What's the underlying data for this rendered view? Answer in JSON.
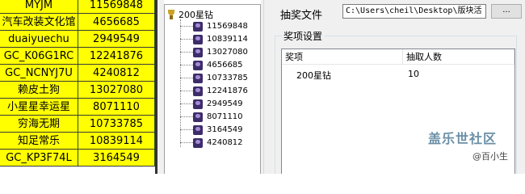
{
  "left_table": {
    "rows": [
      {
        "name": "MYJM",
        "id": "11569848"
      },
      {
        "name": "汽车改装文化馆",
        "id": "4656685"
      },
      {
        "name": "duaiyuechu",
        "id": "2949549"
      },
      {
        "name": "GC_K06G1RC",
        "id": "12241876"
      },
      {
        "name": "GC_NCNYJ7U",
        "id": "4240812"
      },
      {
        "name": "赖皮土狗",
        "id": "13027080"
      },
      {
        "name": "小星星幸运星",
        "id": "8071110"
      },
      {
        "name": "穷海无期",
        "id": "10733785"
      },
      {
        "name": "知足常乐",
        "id": "10839114"
      },
      {
        "name": "GC_KP3F74L",
        "id": "3164549"
      }
    ]
  },
  "tree": {
    "root": "200星钻",
    "items": [
      "11569848",
      "10839114",
      "13027080",
      "4656685",
      "10733785",
      "12241876",
      "2949549",
      "8071110",
      "3164549",
      "4240812"
    ]
  },
  "right": {
    "file_label": "抽奖文件",
    "file_path": "C:\\Users\\cheil\\Desktop\\版块活",
    "browse_label": "...",
    "group_title": "奖项设置",
    "columns": [
      "奖项",
      "抽取人数"
    ],
    "rows": [
      {
        "prize": "200星钻",
        "count": "10"
      }
    ]
  },
  "watermark": {
    "main": "盖乐世社区",
    "sub": "@百小生"
  }
}
